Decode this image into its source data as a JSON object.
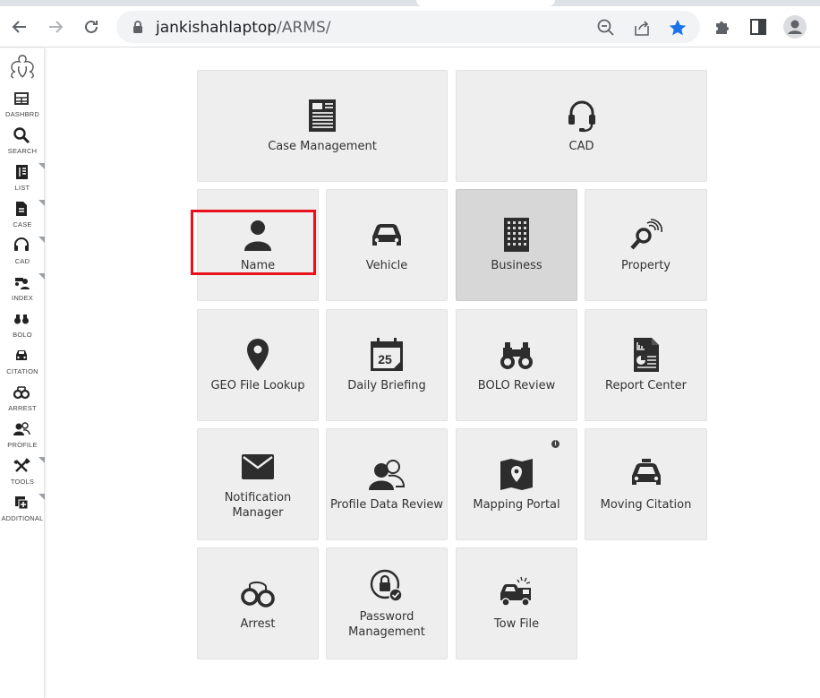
{
  "browser": {
    "url_host": "jankishahlaptop",
    "url_path": "/ARMS/"
  },
  "sidebar": {
    "items": [
      {
        "label": "DASHBRD",
        "icon": "grid-icon",
        "submenu": false
      },
      {
        "label": "SEARCH",
        "icon": "search-icon",
        "submenu": false
      },
      {
        "label": "LIST",
        "icon": "list-icon",
        "submenu": true
      },
      {
        "label": "CASE",
        "icon": "document-icon",
        "submenu": true
      },
      {
        "label": "CAD",
        "icon": "headset-icon",
        "submenu": true
      },
      {
        "label": "INDEX",
        "icon": "index-icon",
        "submenu": true
      },
      {
        "label": "BOLO",
        "icon": "binoculars-icon",
        "submenu": false
      },
      {
        "label": "CITATION",
        "icon": "car-icon",
        "submenu": false
      },
      {
        "label": "ARREST",
        "icon": "handcuffs-icon",
        "submenu": false
      },
      {
        "label": "PROFILE",
        "icon": "users-icon",
        "submenu": false
      },
      {
        "label": "TOOLS",
        "icon": "tools-icon",
        "submenu": true
      },
      {
        "label": "ADDITIONAL",
        "icon": "add-box-icon",
        "submenu": true
      }
    ]
  },
  "tiles": {
    "case_management": "Case Management",
    "cad": "CAD",
    "name": "Name",
    "vehicle": "Vehicle",
    "business": "Business",
    "property": "Property",
    "geo_file_lookup": "GEO File Lookup",
    "daily_briefing": "Daily Briefing",
    "daily_briefing_day": "25",
    "bolo_review": "BOLO Review",
    "report_center": "Report Center",
    "notification_manager": "Notification Manager",
    "profile_data_review": "Profile Data Review",
    "mapping_portal": "Mapping Portal",
    "mapping_portal_info": "i",
    "moving_citation": "Moving Citation",
    "arrest": "Arrest",
    "password_management": "Password Management",
    "tow_file": "Tow File"
  },
  "colors": {
    "tile_bg": "#eeeeee",
    "tile_selected_bg": "#d7d7d7",
    "icon_dark": "#2d2d2d",
    "highlight_red": "#e8101a",
    "star_blue": "#1a73e8"
  }
}
